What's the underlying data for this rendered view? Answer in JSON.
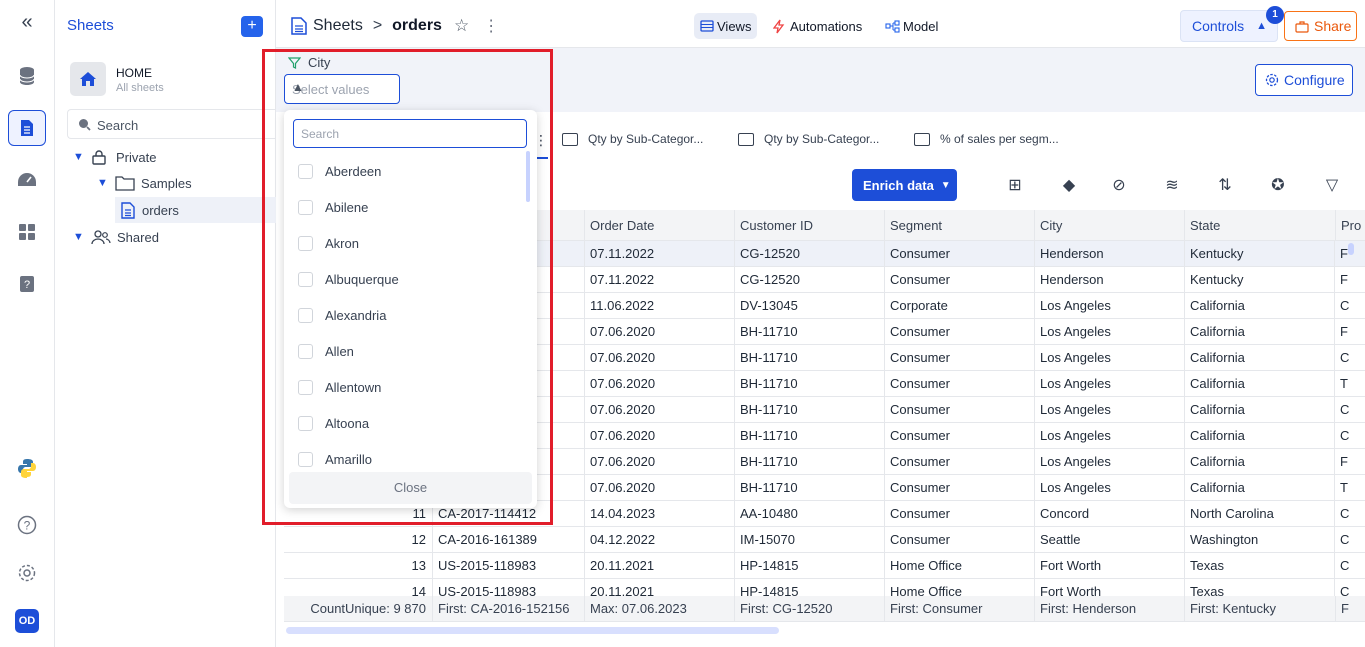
{
  "sidebar": {
    "title": "Sheets",
    "home_title": "HOME",
    "home_sub": "All sheets",
    "search_placeholder": "Search",
    "tree": {
      "private": "Private",
      "samples": "Samples",
      "orders": "orders",
      "shared": "Shared"
    }
  },
  "rail": {
    "avatar": "OD"
  },
  "topbar": {
    "crumb_root": "Sheets",
    "crumb_sep": ">",
    "crumb_current": "orders",
    "views": "Views",
    "automations": "Automations",
    "model": "Model",
    "controls": "Controls",
    "controls_badge": "1",
    "share": "Share"
  },
  "filter": {
    "label": "City",
    "select_placeholder": "Select values",
    "configure": "Configure"
  },
  "tabs": [
    "Qty by Sub-Categor...",
    "Qty by Sub-Categor...",
    "% of sales per segm..."
  ],
  "toolbar": {
    "enrich": "Enrich data"
  },
  "table": {
    "columns": [
      "Order Date",
      "Customer ID",
      "Segment",
      "City",
      "State",
      "Pro"
    ],
    "rows": [
      [
        "",
        "",
        "07.11.2022",
        "CG-12520",
        "Consumer",
        "Henderson",
        "Kentucky",
        "F"
      ],
      [
        "",
        "",
        "07.11.2022",
        "CG-12520",
        "Consumer",
        "Henderson",
        "Kentucky",
        "F"
      ],
      [
        "",
        "",
        "11.06.2022",
        "DV-13045",
        "Corporate",
        "Los Angeles",
        "California",
        "C"
      ],
      [
        "",
        "",
        "07.06.2020",
        "BH-11710",
        "Consumer",
        "Los Angeles",
        "California",
        "F"
      ],
      [
        "",
        "",
        "07.06.2020",
        "BH-11710",
        "Consumer",
        "Los Angeles",
        "California",
        "C"
      ],
      [
        "",
        "",
        "07.06.2020",
        "BH-11710",
        "Consumer",
        "Los Angeles",
        "California",
        "T"
      ],
      [
        "",
        "",
        "07.06.2020",
        "BH-11710",
        "Consumer",
        "Los Angeles",
        "California",
        "C"
      ],
      [
        "",
        "",
        "07.06.2020",
        "BH-11710",
        "Consumer",
        "Los Angeles",
        "California",
        "C"
      ],
      [
        "",
        "",
        "07.06.2020",
        "BH-11710",
        "Consumer",
        "Los Angeles",
        "California",
        "F"
      ],
      [
        "",
        "",
        "07.06.2020",
        "BH-11710",
        "Consumer",
        "Los Angeles",
        "California",
        "T"
      ],
      [
        "11",
        "CA-2017-114412",
        "14.04.2023",
        "AA-10480",
        "Consumer",
        "Concord",
        "North Carolina",
        "C"
      ],
      [
        "12",
        "CA-2016-161389",
        "04.12.2022",
        "IM-15070",
        "Consumer",
        "Seattle",
        "Washington",
        "C"
      ],
      [
        "13",
        "US-2015-118983",
        "20.11.2021",
        "HP-14815",
        "Home Office",
        "Fort Worth",
        "Texas",
        "C"
      ],
      [
        "14",
        "US-2015-118983",
        "20.11.2021",
        "HP-14815",
        "Home Office",
        "Fort Worth",
        "Texas",
        "C"
      ]
    ],
    "footer": [
      "CountUnique: 9 870",
      "First: CA-2016-152156",
      "Max: 07.06.2023",
      "First: CG-12520",
      "First: Consumer",
      "First: Henderson",
      "First: Kentucky",
      "F"
    ]
  },
  "dropdown": {
    "search_placeholder": "Search",
    "items": [
      "Aberdeen",
      "Abilene",
      "Akron",
      "Albuquerque",
      "Alexandria",
      "Allen",
      "Allentown",
      "Altoona",
      "Amarillo"
    ],
    "close": "Close"
  },
  "colors": {
    "accent": "#1d4ed8",
    "share": "#ea580c",
    "highlight": "#e11d2a"
  }
}
